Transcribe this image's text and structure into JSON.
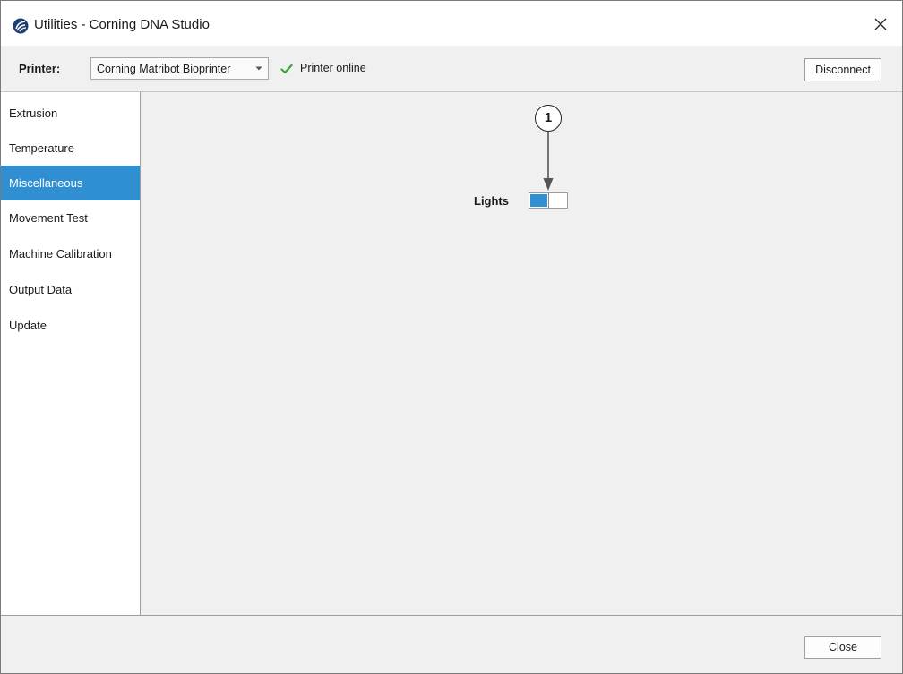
{
  "window": {
    "title": "Utilities - Corning DNA Studio",
    "app_icon": "corning-logo-icon",
    "close_icon": "close-icon"
  },
  "toolbar": {
    "printer_label": "Printer:",
    "printer_selected": "Corning Matribot Bioprinter",
    "status_icon": "checkmark-icon",
    "status_text": "Printer online",
    "disconnect_label": "Disconnect"
  },
  "sidebar": {
    "items": [
      {
        "label": "Extrusion",
        "active": false
      },
      {
        "label": "Temperature",
        "active": false
      },
      {
        "label": "Miscellaneous",
        "active": true
      },
      {
        "label": "Movement Test",
        "active": false
      },
      {
        "label": "Machine Calibration",
        "active": false
      },
      {
        "label": "Output Data",
        "active": false
      },
      {
        "label": "Update",
        "active": false
      }
    ]
  },
  "main": {
    "lights_label": "Lights",
    "lights_on": true,
    "callout_number": "1"
  },
  "footer": {
    "close_label": "Close"
  },
  "colors": {
    "accent": "#2f8fd0",
    "status_ok": "#3aa63a",
    "panel_bg": "#f0f0f0"
  }
}
